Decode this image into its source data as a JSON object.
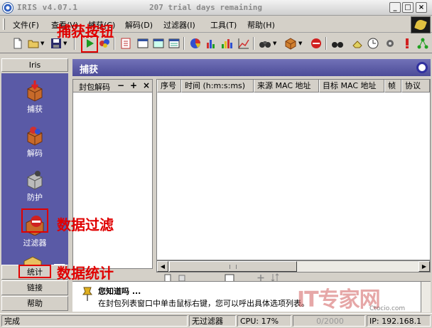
{
  "window": {
    "title": "IRIS v4.07.1",
    "trial": "207 trial days remaining",
    "buttons": {
      "minimize": "_",
      "maximize": "□",
      "close": "×"
    }
  },
  "menu": {
    "items": [
      "文件(F)",
      "查看(V)",
      "捕获(C)",
      "解码(D)",
      "过滤器(I)",
      "工具(T)",
      "帮助(H)"
    ]
  },
  "toolbar": {
    "icons": [
      "new-icon",
      "open-icon",
      "save-icon",
      "start-capture-icon",
      "multicolor-icon",
      "decode-icon",
      "window1-icon",
      "window2-icon",
      "window3-icon",
      "pie-icon",
      "bar-chart-icon",
      "bar-chart2-icon",
      "line-chart-icon",
      "binoculars-filter-icon",
      "cube-icon",
      "stop-icon",
      "find-icon",
      "eraser-icon",
      "clock-icon",
      "gear-icon",
      "alert-icon",
      "network-icon"
    ]
  },
  "sidebar": {
    "header": "Iris",
    "items": [
      {
        "label": "捕获",
        "icon": "capture-icon"
      },
      {
        "label": "解码",
        "icon": "decode-icon"
      },
      {
        "label": "防护",
        "icon": "protect-icon"
      },
      {
        "label": "过滤器",
        "icon": "filter-icon"
      }
    ],
    "bars": [
      "统计",
      "链接",
      "帮助"
    ]
  },
  "main": {
    "title": "捕获",
    "decode_pane": {
      "label": "封包解码",
      "minus": "−",
      "plus": "+",
      "close": "×"
    },
    "columns": [
      "序号",
      "时间 (h:m:s:ms)",
      "来源 MAC 地址",
      "目标 MAC 地址",
      "帧",
      "协议"
    ]
  },
  "tip": {
    "question": "您知道吗 ...",
    "message": "在封包列表窗口中单击鼠标右键，您可以呼出具体选项列表。"
  },
  "status": {
    "state": "完成",
    "filter": "无过滤器",
    "cpu": "CPU: 17%",
    "progress": "0/2000",
    "ip": "IP: 192.168.1"
  },
  "annotations": {
    "capture_button": "捕获按钮",
    "data_filter": "数据过滤",
    "data_stats": "数据统计"
  },
  "watermark": {
    "brand": "IT专家网",
    "site": "Ctocio.com"
  },
  "colors": {
    "sidebar_panel": "#5a5aa6",
    "header": "#5c5ca8",
    "annotation": "#e00000"
  }
}
